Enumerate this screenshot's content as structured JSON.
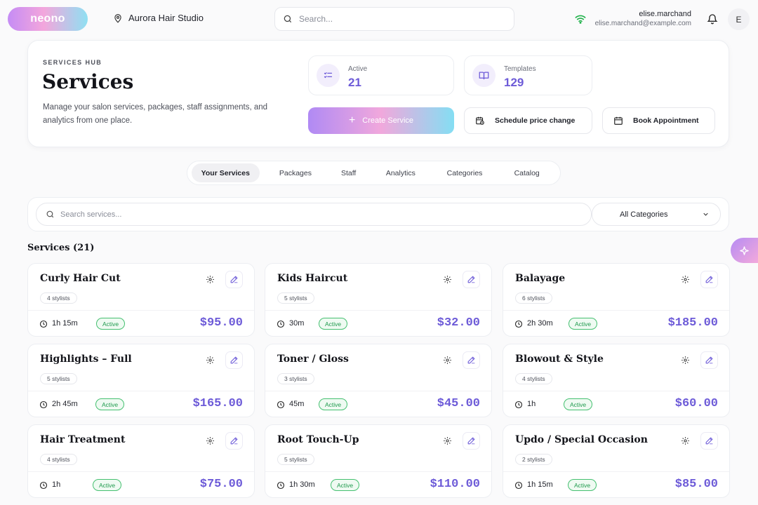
{
  "app": {
    "logo": "neono",
    "studio": "Aurora Hair Studio"
  },
  "search": {
    "placeholder": "Search..."
  },
  "user": {
    "name": "elise.marchand",
    "email": "elise.marchand@example.com",
    "initial": "E"
  },
  "hero": {
    "eyebrow": "SERVICES HUB",
    "title": "Services",
    "description": "Manage your salon services, packages, staff assignments, and analytics from one place.",
    "stats": [
      {
        "label": "Active",
        "value": "21",
        "icon": "checklist-icon"
      },
      {
        "label": "Templates",
        "value": "129",
        "icon": "book-icon"
      }
    ],
    "actions": {
      "create": "Create Service",
      "schedule": "Schedule price change",
      "book": "Book Appointment"
    }
  },
  "tabs": [
    "Your Services",
    "Packages",
    "Staff",
    "Analytics",
    "Categories",
    "Catalog"
  ],
  "filter": {
    "placeholder": "Search services...",
    "category": "All Categories"
  },
  "list_title": "Services (21)",
  "services": [
    {
      "name": "Curly Hair Cut",
      "stylists": "4 stylists",
      "duration": "1h 15m",
      "status": "Active",
      "price": "$95.00"
    },
    {
      "name": "Kids Haircut",
      "stylists": "5 stylists",
      "duration": "30m",
      "status": "Active",
      "price": "$32.00"
    },
    {
      "name": "Balayage",
      "stylists": "6 stylists",
      "duration": "2h 30m",
      "status": "Active",
      "price": "$185.00"
    },
    {
      "name": "Highlights – Full",
      "stylists": "5 stylists",
      "duration": "2h 45m",
      "status": "Active",
      "price": "$165.00"
    },
    {
      "name": "Toner / Gloss",
      "stylists": "3 stylists",
      "duration": "45m",
      "status": "Active",
      "price": "$45.00"
    },
    {
      "name": "Blowout & Style",
      "stylists": "4 stylists",
      "duration": "1h",
      "status": "Active",
      "price": "$60.00"
    },
    {
      "name": "Hair Treatment",
      "stylists": "4 stylists",
      "duration": "1h",
      "status": "Active",
      "price": "$75.00"
    },
    {
      "name": "Root Touch-Up",
      "stylists": "5 stylists",
      "duration": "1h 30m",
      "status": "Active",
      "price": "$110.00"
    },
    {
      "name": "Updo / Special Occasion",
      "stylists": "2 stylists",
      "duration": "1h 15m",
      "status": "Active",
      "price": "$85.00"
    }
  ],
  "colors": {
    "accent": "#6d5bd8",
    "active_green": "#1f9a4d",
    "wifi": "#22b24c"
  }
}
